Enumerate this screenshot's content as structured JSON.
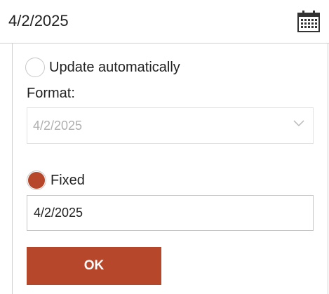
{
  "header": {
    "date_value": "4/2/2025",
    "calendar_icon": "calendar-icon"
  },
  "options": {
    "update_automatically": {
      "label": "Update automatically",
      "checked": false
    },
    "format": {
      "label": "Format:",
      "selected": "4/2/2025",
      "disabled": true,
      "icon": "chevron-down-icon"
    },
    "fixed": {
      "label": "Fixed",
      "checked": true,
      "value": "4/2/2025"
    }
  },
  "ok_button": {
    "label": "OK"
  },
  "colors": {
    "accent": "#b7472a",
    "border": "#d0d0d0",
    "disabled_text": "#b0b0b0"
  }
}
